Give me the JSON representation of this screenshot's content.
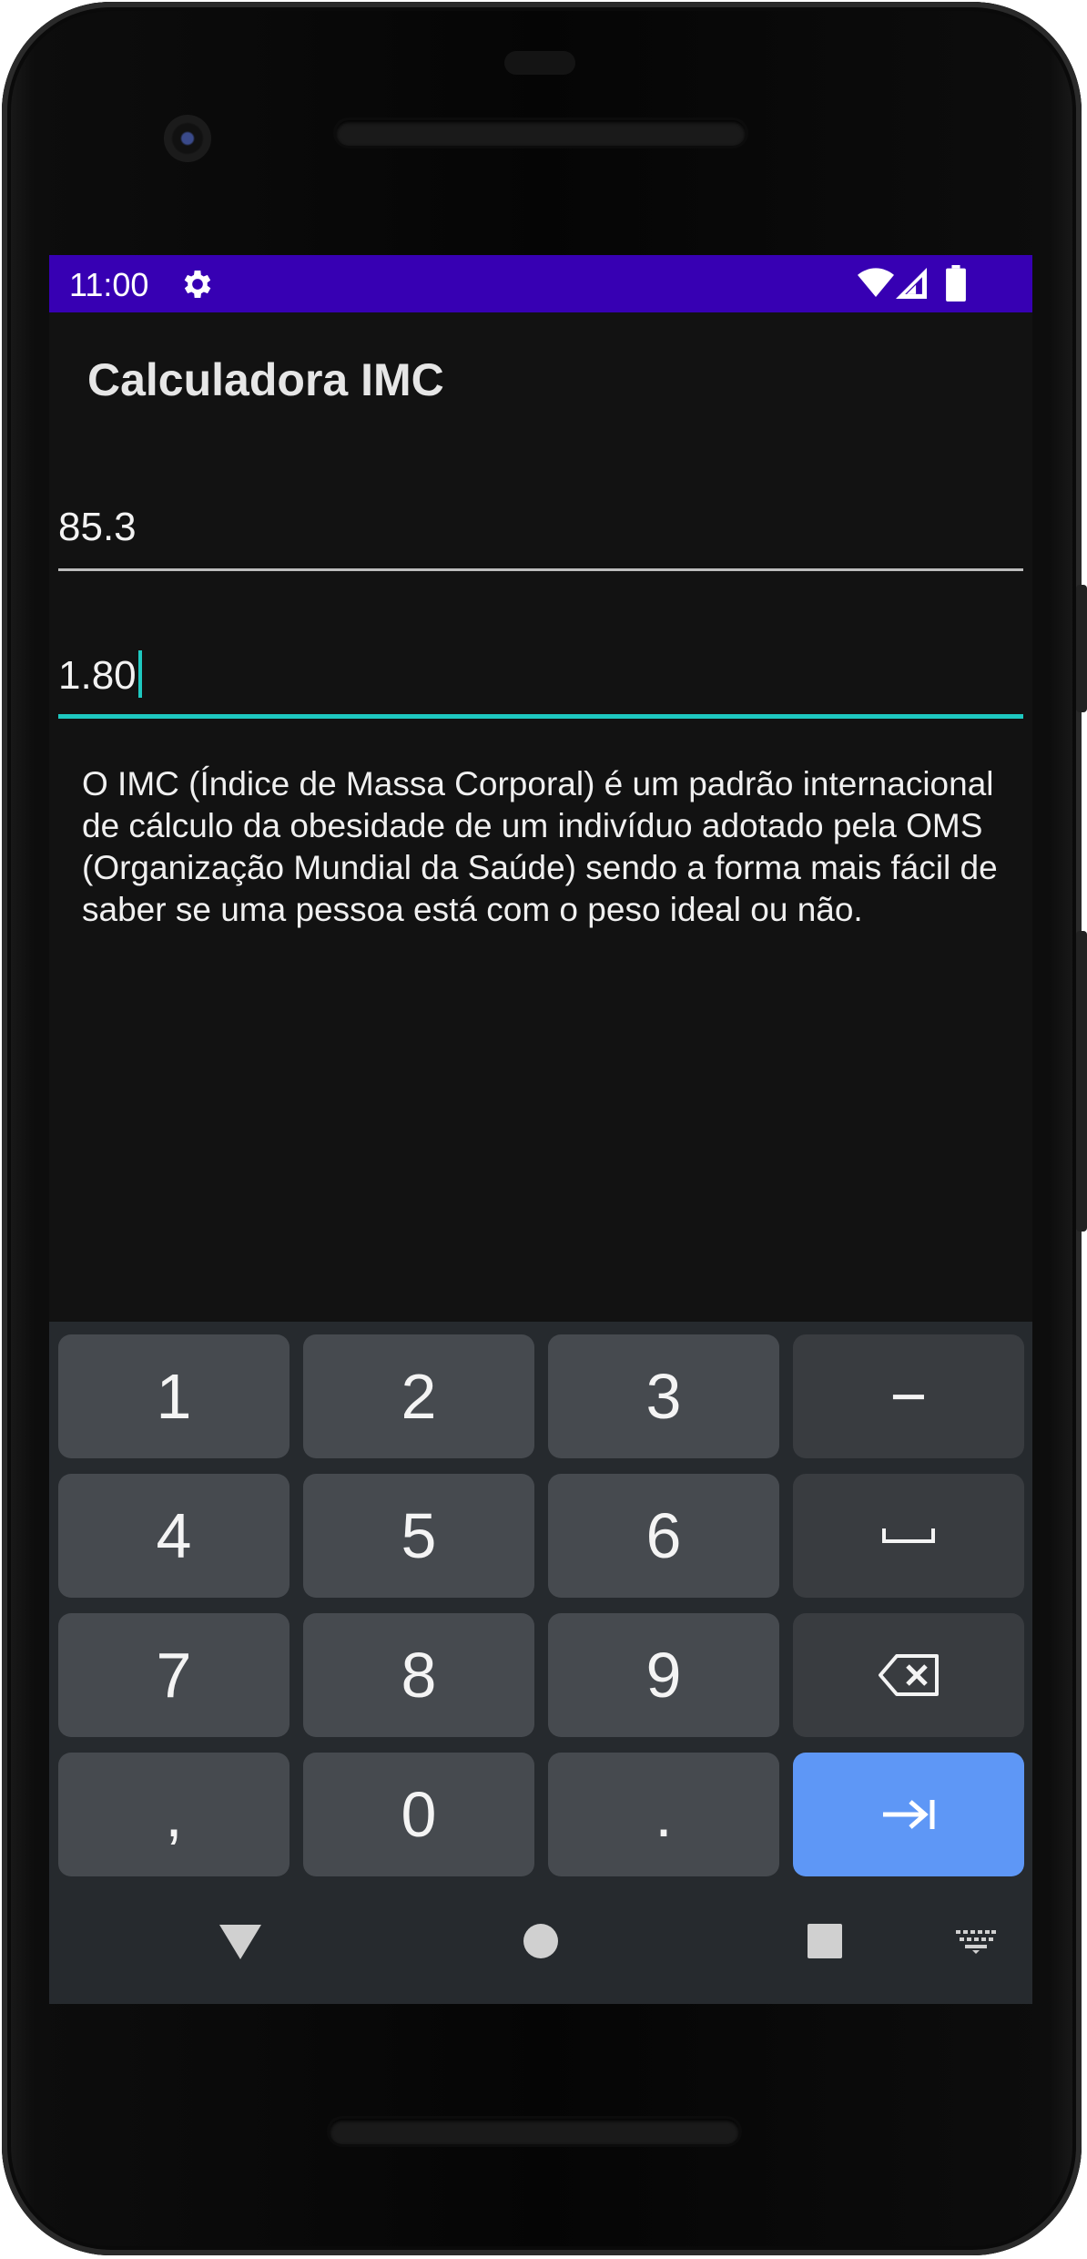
{
  "status_bar": {
    "time": "11:00",
    "icons": [
      "gear-icon",
      "wifi-icon",
      "signal-icon",
      "battery-icon"
    ],
    "background_color": "#3700b3"
  },
  "app": {
    "title": "Calculadora IMC"
  },
  "inputs": {
    "weight": {
      "value": "85.3"
    },
    "height": {
      "value": "1.80",
      "focused": true,
      "accent_color": "#1ec8c0"
    }
  },
  "description": "O IMC (Índice de Massa Corporal) é um padrão internacional de cálculo da obesidade de um indivíduo adotado pela OMS (Organização Mundial da Saúde) sendo a forma mais fácil de saber se uma pessoa está com o peso ideal ou não.",
  "keyboard": {
    "rows": [
      [
        "1",
        "2",
        "3",
        "−"
      ],
      [
        "4",
        "5",
        "6",
        "space-icon"
      ],
      [
        "7",
        "8",
        "9",
        "backspace-icon"
      ],
      [
        ",",
        "0",
        ".",
        "next-tab-icon"
      ]
    ],
    "action_color": "#5e97f6"
  },
  "navigation": {
    "buttons": [
      "back-triangle-icon",
      "home-circle-icon",
      "recents-square-icon",
      "keyboard-switch-icon"
    ]
  }
}
